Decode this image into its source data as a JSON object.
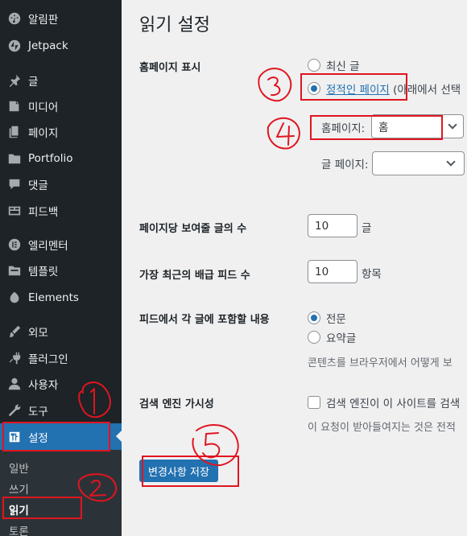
{
  "sidebar": {
    "items": [
      {
        "label": "알림판",
        "icon": "dashboard-icon"
      },
      {
        "label": "Jetpack",
        "icon": "jetpack-icon"
      },
      {
        "label": "글",
        "icon": "pin-icon"
      },
      {
        "label": "미디어",
        "icon": "media-icon"
      },
      {
        "label": "페이지",
        "icon": "page-icon"
      },
      {
        "label": "Portfolio",
        "icon": "folder-icon"
      },
      {
        "label": "댓글",
        "icon": "comment-icon"
      },
      {
        "label": "피드백",
        "icon": "feedback-icon"
      },
      {
        "label": "엘리멘터",
        "icon": "elementor-icon"
      },
      {
        "label": "템플릿",
        "icon": "templates-icon"
      },
      {
        "label": "Elements",
        "icon": "elements-icon"
      },
      {
        "label": "외모",
        "icon": "brush-icon"
      },
      {
        "label": "플러그인",
        "icon": "plugin-icon"
      },
      {
        "label": "사용자",
        "icon": "user-icon"
      },
      {
        "label": "도구",
        "icon": "wrench-icon"
      },
      {
        "label": "설정",
        "icon": "settings-icon"
      }
    ],
    "submenu": [
      "일반",
      "쓰기",
      "읽기",
      "토론"
    ]
  },
  "page": {
    "title": "읽기 설정",
    "homepage_display": {
      "label": "홈페이지 표시",
      "option_latest": "최신 글",
      "option_static_link": "정적인 페이지",
      "option_static_suffix": "(아래에서 선택",
      "homepage_label": "홈페이지:",
      "homepage_value": "홈",
      "posts_page_label": "글 페이지:",
      "posts_page_value": ""
    },
    "posts_per_page": {
      "label": "페이지당 보여줄 글의 수",
      "value": "10",
      "unit": "글"
    },
    "feed_items": {
      "label": "가장 최근의 배급 피드 수",
      "value": "10",
      "unit": "항목"
    },
    "feed_content": {
      "label": "피드에서 각 글에 포함할 내용",
      "option_full": "전문",
      "option_summary": "요약글",
      "note": "콘텐츠를 브라우저에서 어떻게 보"
    },
    "search_visibility": {
      "label": "검색 엔진 가시성",
      "checkbox_label": "검색 엔진이 이 사이트를 검색",
      "note": "이 요청이 받아들여지는 것은 전적"
    },
    "save_button": "변경사항 저장"
  },
  "colors": {
    "accent": "#2271b1",
    "sidebar_bg": "#1d2327",
    "annotation": "#e0151f"
  }
}
